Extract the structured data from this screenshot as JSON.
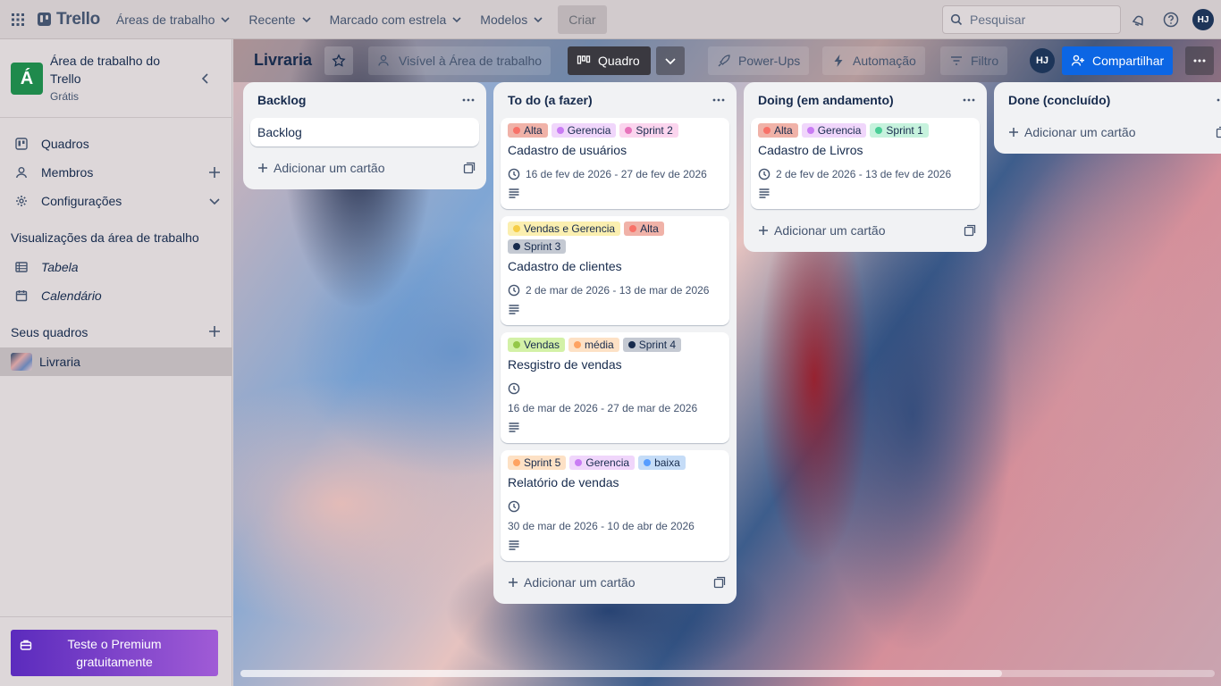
{
  "topbar": {
    "logo": "Trello",
    "menus": [
      "Áreas de trabalho",
      "Recente",
      "Marcado com estrela",
      "Modelos"
    ],
    "create": "Criar",
    "search_placeholder": "Pesquisar",
    "avatar": "HJ"
  },
  "sidebar": {
    "workspace_tile": "Á",
    "workspace_name": "Área de trabalho do Trello",
    "workspace_plan": "Grátis",
    "items": [
      {
        "label": "Quadros"
      },
      {
        "label": "Membros"
      },
      {
        "label": "Configurações"
      }
    ],
    "views_heading": "Visualizações da área de trabalho",
    "views": [
      {
        "label": "Tabela"
      },
      {
        "label": "Calendário"
      }
    ],
    "boards_heading": "Seus quadros",
    "boards": [
      {
        "label": "Livraria"
      }
    ],
    "premium": "Teste o Premium gratuitamente"
  },
  "board": {
    "title": "Livraria",
    "visibility": "Visível à Área de trabalho",
    "view": "Quadro",
    "powerups": "Power-Ups",
    "automation": "Automação",
    "filter": "Filtro",
    "avatar": "HJ",
    "share": "Compartilhar",
    "add_card": "Adicionar um cartão"
  },
  "colors": {
    "red": "#f87168",
    "red_bg": "#f0b2a8",
    "purple": "#c97cf4",
    "purple_bg": "#f0d6fb",
    "pink": "#e774bb",
    "pink_bg": "#fbd5ee",
    "green": "#4bce97",
    "green_bg": "#c6f2dd",
    "yellow": "#f5cd47",
    "yellow_bg": "#fbefb0",
    "navy": "#172b4d",
    "navy_bg": "#c4c9d2",
    "orange": "#fea362",
    "orange_bg": "#fde1c5",
    "lightgreen": "#94c748",
    "lightgreen_bg": "#d3f1a7",
    "blue": "#579dff",
    "blue_bg": "#c5dcf7"
  },
  "lists": [
    {
      "name": "Backlog",
      "cards": [
        {
          "title": "Backlog",
          "simple": true
        }
      ]
    },
    {
      "name": "To do (a fazer)",
      "cards": [
        {
          "labels": [
            {
              "text": "Alta",
              "color": "red"
            },
            {
              "text": "Gerencia",
              "color": "purple"
            },
            {
              "text": "Sprint 2",
              "color": "pink"
            }
          ],
          "title": "Cadastro de usuários",
          "dates": "16 de fev de 2026 - 27 de fev de 2026"
        },
        {
          "labels": [
            {
              "text": "Vendas e Gerencia",
              "color": "yellow"
            },
            {
              "text": "Alta",
              "color": "red"
            },
            {
              "text": "Sprint 3",
              "color": "navy"
            }
          ],
          "title": "Cadastro de clientes",
          "dates": "2 de mar de 2026 - 13 de mar de 2026"
        },
        {
          "labels": [
            {
              "text": "Vendas",
              "color": "lightgreen"
            },
            {
              "text": "média",
              "color": "orange"
            },
            {
              "text": "Sprint 4",
              "color": "navy"
            }
          ],
          "title": "Resgistro de vendas",
          "dates": "16 de mar de 2026 - 27 de mar de 2026",
          "wrap_date": true
        },
        {
          "labels": [
            {
              "text": "Sprint 5",
              "color": "orange"
            },
            {
              "text": "Gerencia",
              "color": "purple"
            },
            {
              "text": "baixa",
              "color": "blue"
            }
          ],
          "title": "Relatório de vendas",
          "dates": "30 de mar de 2026 - 10 de abr de 2026",
          "wrap_date": true
        }
      ]
    },
    {
      "name": "Doing (em andamento)",
      "cards": [
        {
          "labels": [
            {
              "text": "Alta",
              "color": "red"
            },
            {
              "text": "Gerencia",
              "color": "purple"
            },
            {
              "text": "Sprint 1",
              "color": "green"
            }
          ],
          "title": "Cadastro de Livros",
          "dates": "2 de fev de 2026 - 13 de fev de 2026"
        }
      ]
    },
    {
      "name": "Done (concluído)",
      "cards": []
    }
  ]
}
